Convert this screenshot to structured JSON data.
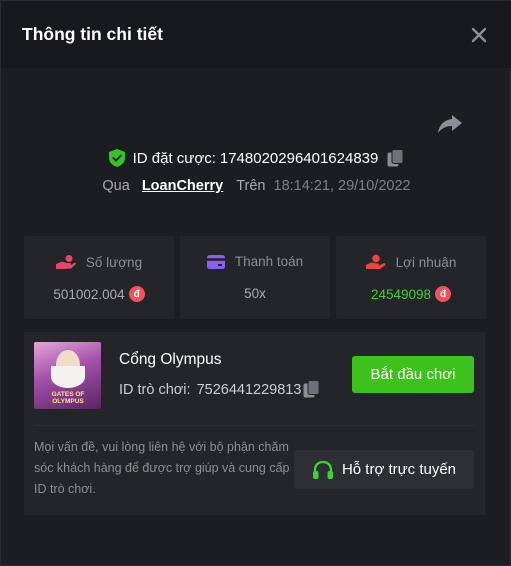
{
  "header": {
    "title": "Thông tin chi tiết"
  },
  "bet": {
    "id_label": "ID đặt cược:",
    "id_value": "1748020296401624839",
    "via": "Qua",
    "user": "LoanCherry",
    "on": "Trên",
    "timestamp": "18:14:21, 29/10/2022"
  },
  "stats": [
    {
      "label": "Số lượng",
      "value": "501002.004",
      "currency": "đ"
    },
    {
      "label": "Thanh toán",
      "value": "50x"
    },
    {
      "label": "Lợi nhuận",
      "value": "24549098",
      "currency": "đ"
    }
  ],
  "game": {
    "thumb_text": "GATES OF OLYMPUS",
    "name": "Cổng Olympus",
    "id_label": "ID trò chơi:",
    "id_value": "7526441229813",
    "play_label": "Bắt đầu chơi"
  },
  "support": {
    "note": "Mọi vấn đề, vui lòng liên hệ với bộ phận chăm sóc khách hàng để được trợ giúp và cung cấp ID trò chơi.",
    "button_label": "Hỗ trợ trực tuyến"
  },
  "colors": {
    "accent_green": "#3dc21b",
    "profit_green": "#3ed331",
    "coin_red": "#f2525e",
    "stat_pink": "#e8456a",
    "stat_purple": "#8b5cf6",
    "stat_red": "#ef4444"
  }
}
